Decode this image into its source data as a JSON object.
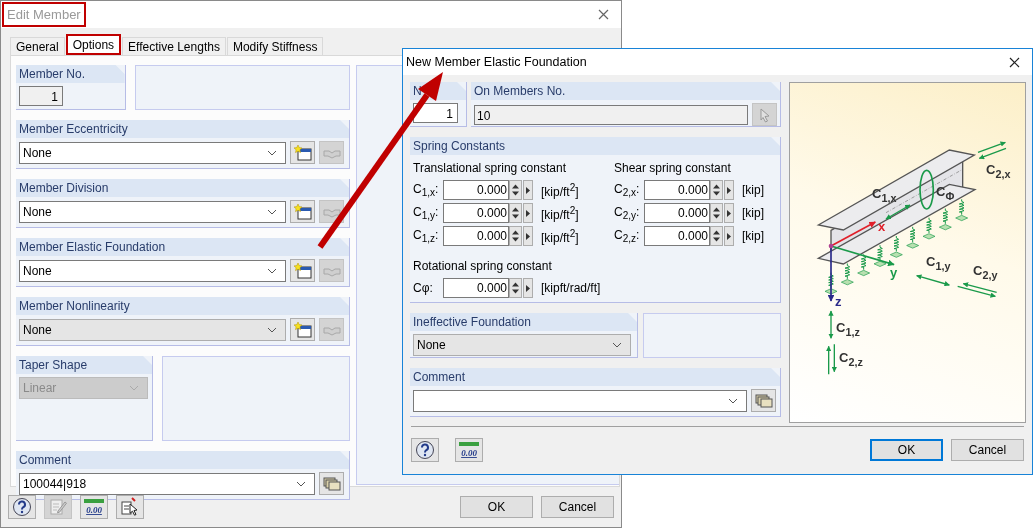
{
  "edit_member": {
    "title": "Edit Member",
    "title_highlighted": true,
    "tabs": [
      {
        "label": "General",
        "selected": false,
        "highlighted": false
      },
      {
        "label": "Options",
        "selected": true,
        "highlighted": true
      },
      {
        "label": "Effective Lengths",
        "selected": false,
        "highlighted": false
      },
      {
        "label": "Modify Stiffness",
        "selected": false,
        "highlighted": false
      }
    ],
    "member_no": {
      "label": "Member No.",
      "value": "1"
    },
    "properties": [
      {
        "label": "Member Eccentricity",
        "value": "None",
        "editable": true
      },
      {
        "label": "Member Division",
        "value": "None",
        "editable": true
      },
      {
        "label": "Member Elastic Foundation",
        "value": "None",
        "editable": true
      },
      {
        "label": "Member Nonlinearity",
        "value": "None",
        "editable": false
      }
    ],
    "taper_shape": {
      "label": "Taper Shape",
      "value": "Linear",
      "disabled": true
    },
    "comment": {
      "label": "Comment",
      "value": "100044|918",
      "editable": true
    },
    "units_button": "0.00",
    "buttons": [
      {
        "label": "OK",
        "default": false
      },
      {
        "label": "Cancel",
        "default": false
      }
    ]
  },
  "new_member_elastic_foundation": {
    "title": "New Member Elastic Foundation",
    "number": {
      "label": "N",
      "value": "1"
    },
    "on_members": {
      "label": "On Members No.",
      "value": "10"
    },
    "spring_constants": {
      "title": "Spring Constants",
      "translational": {
        "heading": "Translational spring constant",
        "rows": [
          {
            "symbol": "C$_{1,x}$:",
            "value": "0.000",
            "unit": "[kip/ft$^{2}$]"
          },
          {
            "symbol": "C$_{1,y}$:",
            "value": "0.000",
            "unit": "[kip/ft$^{2}$]"
          },
          {
            "symbol": "C$_{1,z}$:",
            "value": "0.000",
            "unit": "[kip/ft$^{2}$]"
          }
        ]
      },
      "shear": {
        "heading": "Shear spring constant",
        "rows": [
          {
            "symbol": "C$_{2,x}$:",
            "value": "0.000",
            "unit": "[kip]"
          },
          {
            "symbol": "C$_{2,y}$:",
            "value": "0.000",
            "unit": "[kip]"
          },
          {
            "symbol": "C$_{2,z}$:",
            "value": "0.000",
            "unit": "[kip]"
          }
        ]
      },
      "rotational": {
        "heading": "Rotational spring constant",
        "rows": [
          {
            "symbol": "Cφ:",
            "value": "0.000",
            "unit": "[kipft/rad/ft]"
          }
        ]
      }
    },
    "ineffective_foundation": {
      "label": "Ineffective Foundation",
      "value": "None",
      "editable": false
    },
    "comment": {
      "label": "Comment",
      "editable": true
    },
    "diagram_labels": [
      "C$_{2,x}$",
      "C$_{1,x}$",
      "C$_{Φ}$",
      "C$_{1,y}$",
      "C$_{2,y}$",
      "C$_{1,z}$",
      "C$_{2,z}$"
    ],
    "axis_labels": [
      "x",
      "y",
      "z"
    ],
    "units_button": "0.00",
    "buttons": [
      {
        "label": "OK",
        "default": true
      },
      {
        "label": "Cancel",
        "default": false
      }
    ]
  }
}
